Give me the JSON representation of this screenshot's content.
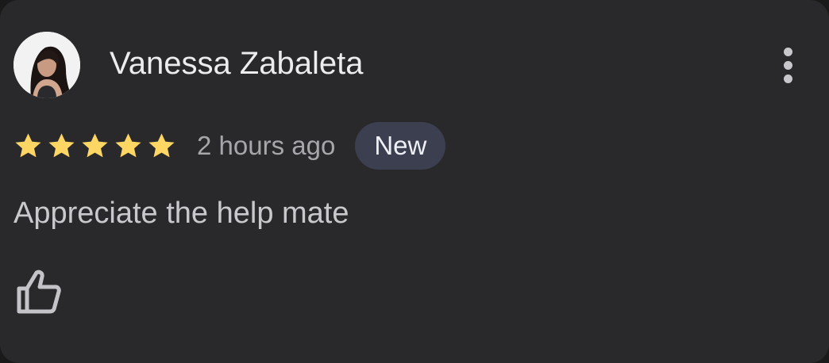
{
  "review": {
    "author_name": "Vanessa Zabaleta",
    "rating": 5,
    "rating_max": 5,
    "time_ago": "2 hours ago",
    "badge": "New",
    "text": "Appreciate the help mate"
  },
  "icons": {
    "more": "more-vertical-icon",
    "star": "star-icon",
    "like": "thumbs-up-icon"
  },
  "colors": {
    "card_background": "#29292b",
    "star": "#fdd663",
    "badge_background": "#3b3f4f",
    "secondary_text": "#a6a6ab"
  }
}
